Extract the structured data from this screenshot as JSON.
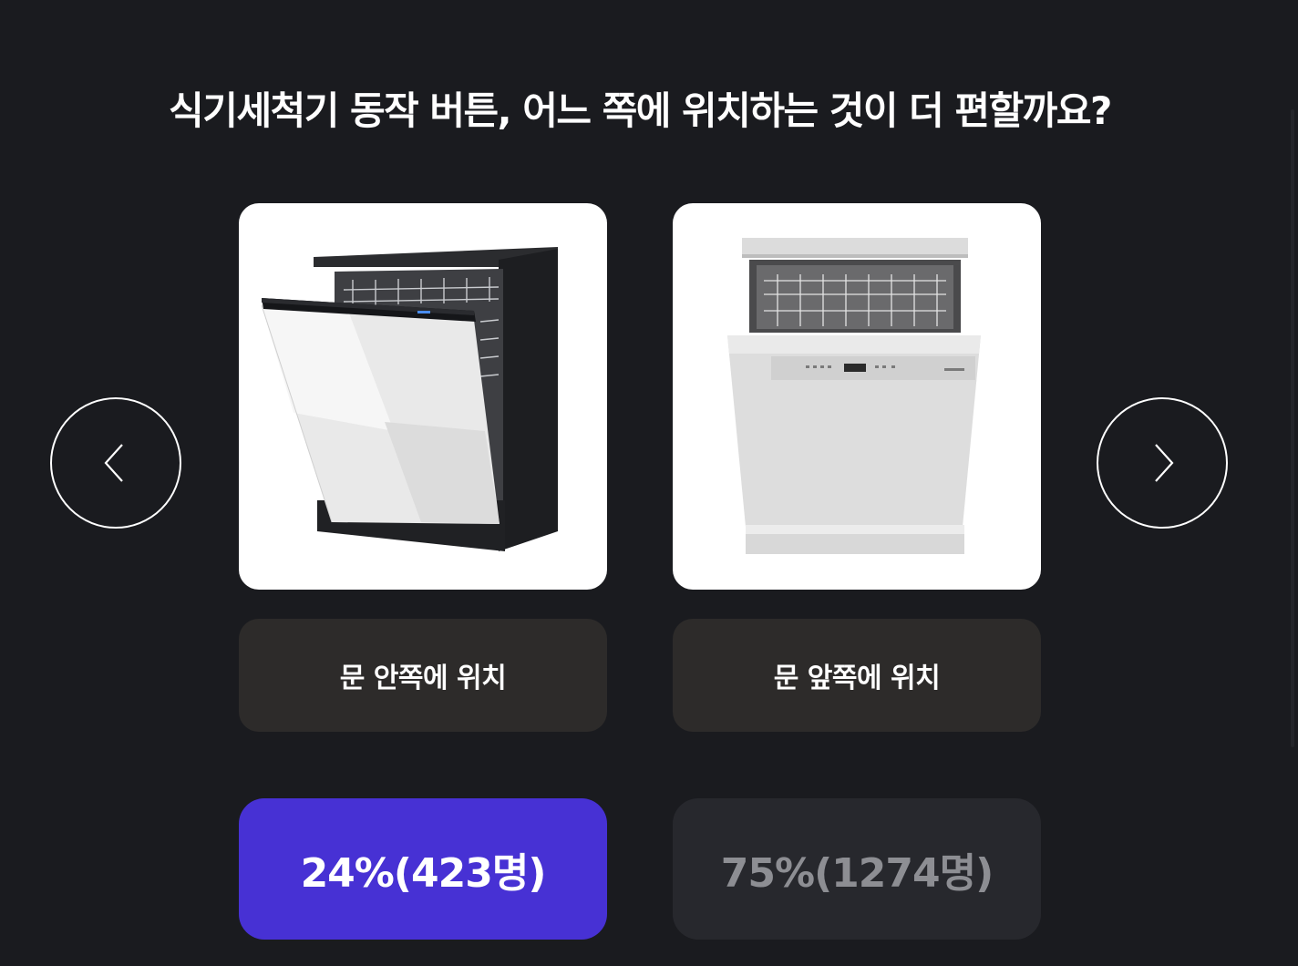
{
  "question": "식기세척기 동작 버튼, 어느 쪽에 위치하는 것이 더 편할까요?",
  "nav": {
    "prev_icon": "chevron-left-icon",
    "next_icon": "chevron-right-icon"
  },
  "options": [
    {
      "label": "문 안쪽에 위치",
      "image": "dishwasher-black-door-open-image",
      "result": "24%(423명)",
      "percent": 24,
      "count": 423,
      "selected": true
    },
    {
      "label": "문 앞쪽에 위치",
      "image": "dishwasher-silver-door-open-image",
      "result": "75%(1274명)",
      "percent": 75,
      "count": 1274,
      "selected": false
    }
  ],
  "colors": {
    "background": "#1a1b1f",
    "option_button_bg": "#2d2b2a",
    "selected_result_bg": "#4731d4",
    "unselected_result_bg": "#27282d",
    "unselected_result_text": "#8d8e93"
  }
}
